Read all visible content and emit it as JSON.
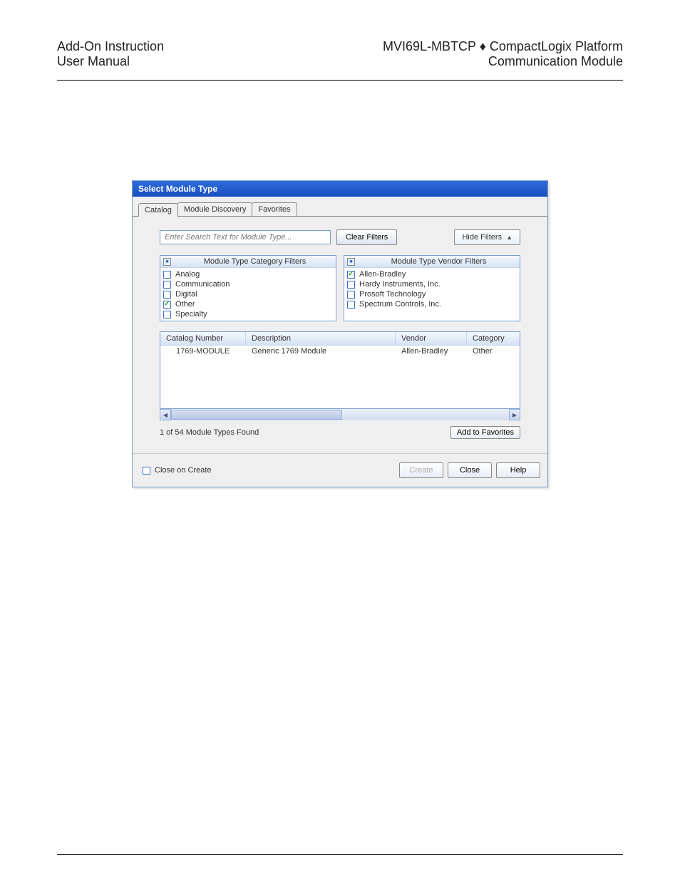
{
  "header": {
    "left1": "Add-On Instruction",
    "left2": "User Manual",
    "right1": "MVI69L-MBTCP ♦ CompactLogix Platform",
    "right2": "Communication Module"
  },
  "dialog": {
    "title": "Select Module Type",
    "tabs": [
      "Catalog",
      "Module Discovery",
      "Favorites"
    ],
    "search_placeholder": "Enter Search Text for Module Type...",
    "clear_filters": "Clear Filters",
    "hide_filters": "Hide Filters",
    "category_filters": {
      "title": "Module Type Category Filters",
      "items": [
        {
          "label": "Analog",
          "checked": false
        },
        {
          "label": "Communication",
          "checked": false
        },
        {
          "label": "Digital",
          "checked": false
        },
        {
          "label": "Other",
          "checked": true
        },
        {
          "label": "Specialty",
          "checked": false
        }
      ]
    },
    "vendor_filters": {
      "title": "Module Type Vendor Filters",
      "items": [
        {
          "label": "Allen-Bradley",
          "checked": true
        },
        {
          "label": "Hardy Instruments, Inc.",
          "checked": false
        },
        {
          "label": "Prosoft Technology",
          "checked": false
        },
        {
          "label": "Spectrum Controls, Inc.",
          "checked": false
        }
      ]
    },
    "grid": {
      "columns": [
        "Catalog Number",
        "Description",
        "Vendor",
        "Category"
      ],
      "rows": [
        {
          "catalog": "1769-MODULE",
          "description": "Generic 1769 Module",
          "vendor": "Allen-Bradley",
          "category": "Other"
        }
      ]
    },
    "status": "1  of 54 Module Types Found",
    "add_to_favorites": "Add to Favorites",
    "close_on_create": "Close on Create",
    "buttons": {
      "create": "Create",
      "close": "Close",
      "help": "Help"
    }
  }
}
